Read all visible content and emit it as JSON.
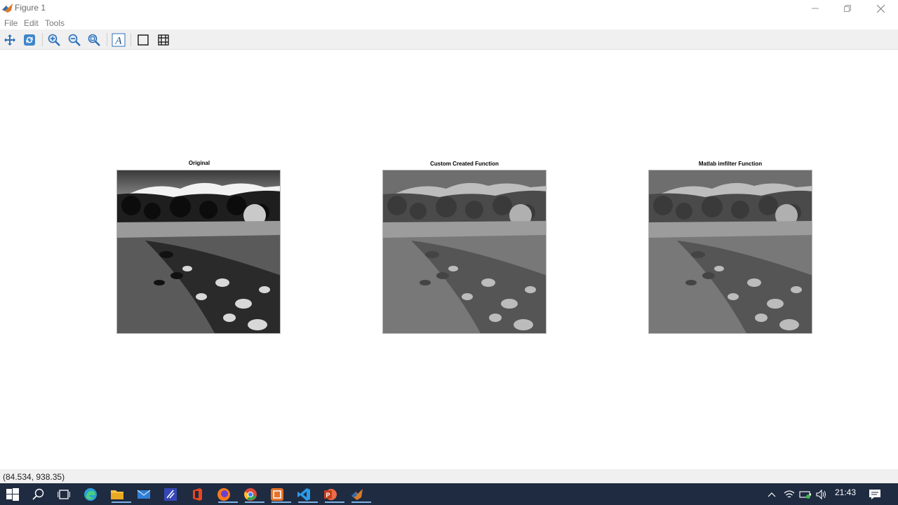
{
  "window": {
    "title": "Figure 1"
  },
  "menu": {
    "items": [
      "File",
      "Edit",
      "Tools"
    ]
  },
  "toolbar": {
    "tools": [
      "pan-icon",
      "rotate-icon",
      "zoom-in-icon",
      "zoom-out-icon",
      "zoom-reset-icon",
      "insert-text-icon",
      "toggle-box-icon",
      "toggle-grid-icon"
    ]
  },
  "panels": [
    {
      "title": "Original",
      "contrast": "high"
    },
    {
      "title": "Custom Created Function",
      "contrast": "low"
    },
    {
      "title": "Matlab imfilter Function",
      "contrast": "low"
    }
  ],
  "status": {
    "coordinates": "(84.534, 938.35)"
  },
  "taskbar": {
    "apps": [
      "start-icon",
      "search-icon",
      "task-view-icon",
      "edge-icon",
      "file-explorer-icon",
      "mail-icon",
      "matlab-editor-icon",
      "office-icon",
      "firefox-icon",
      "chrome-icon",
      "app-icon",
      "vscode-icon",
      "powerpoint-icon",
      "matlab-icon"
    ],
    "clock": "21:43"
  },
  "colors": {
    "taskbar_bg": "#1f2b40",
    "toolbar_bg": "#f0f0f0",
    "accent_blue": "#2d6fb6"
  }
}
